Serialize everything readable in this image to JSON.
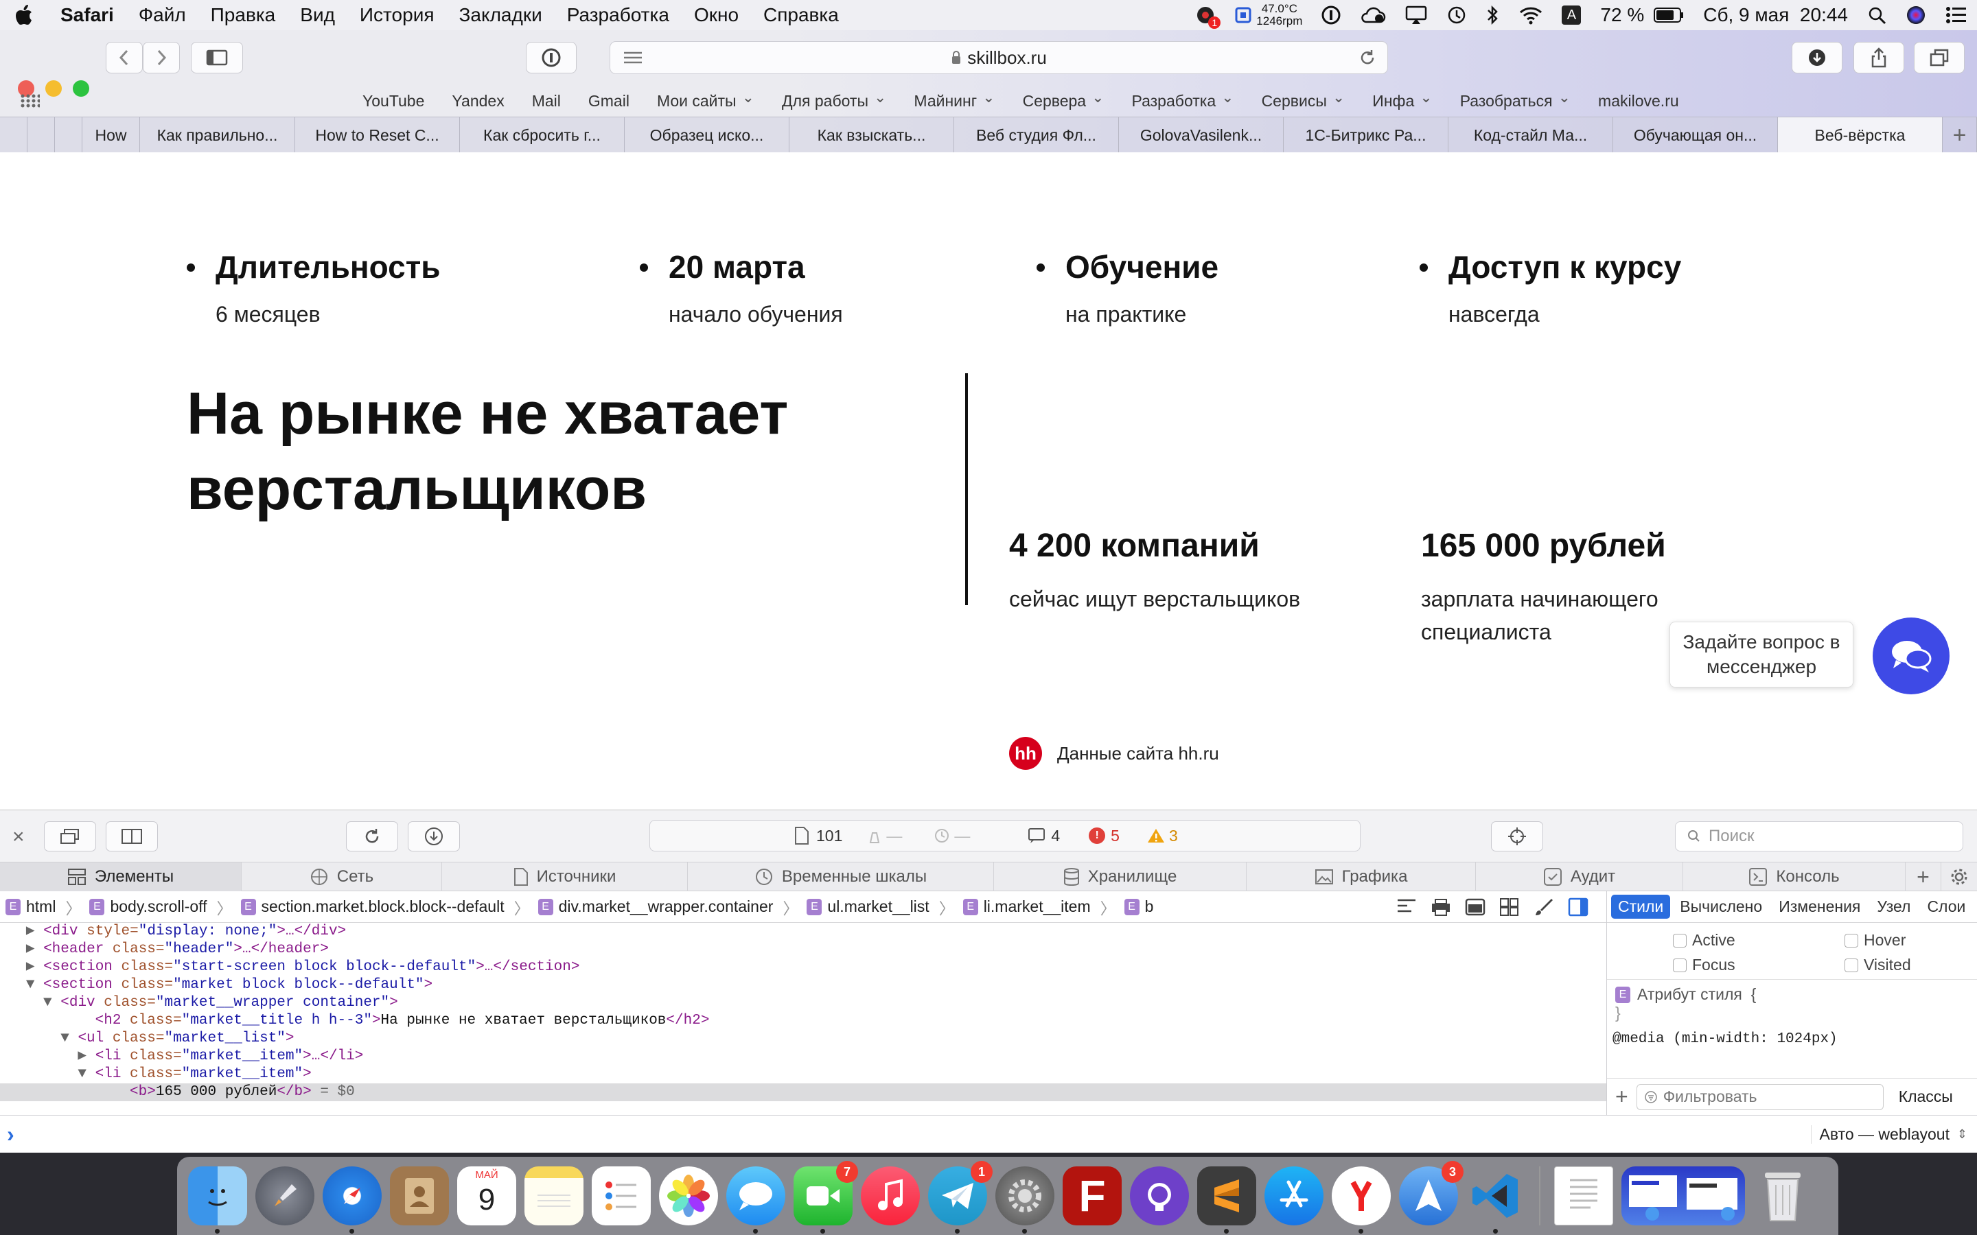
{
  "menubar": {
    "app_name": "Safari",
    "items": [
      "Файл",
      "Правка",
      "Вид",
      "История",
      "Закладки",
      "Разработка",
      "Окно",
      "Справка"
    ],
    "temp": "47.0°C",
    "rpm": "1246rpm",
    "battery": "72 %",
    "datetime": "Сб, 9 мая  20:44",
    "notification_count": "1"
  },
  "browser": {
    "url": "skillbox.ru",
    "favorites": [
      "YouTube",
      "Yandex",
      "Mail",
      "Gmail",
      "Мои сайты",
      "Для работы",
      "Майнинг",
      "Сервера",
      "Разработка",
      "Сервисы",
      "Инфа",
      "Разобраться",
      "makilove.ru"
    ],
    "favorites_with_menu": [
      false,
      false,
      false,
      false,
      true,
      true,
      true,
      true,
      true,
      true,
      true,
      true,
      false
    ],
    "tabs": [
      "How",
      "Как правильно...",
      "How to Reset C...",
      "Как сбросить г...",
      "Образец иско...",
      "Как взыскать...",
      "Веб студия Фл...",
      "GolovaVasilenk...",
      "1С-Битрикс Ра...",
      "Код-стайл Ма...",
      "Обучающая он...",
      "Веб-вёрстка"
    ],
    "active_tab": 11
  },
  "course_stats": [
    {
      "title": "Длительность",
      "sub": "6 месяцев"
    },
    {
      "title": "20 марта",
      "sub": "начало обучения"
    },
    {
      "title": "Обучение",
      "sub": "на практике"
    },
    {
      "title": "Доступ к курсу",
      "sub": "навсегда"
    }
  ],
  "market": {
    "title": "На рынке не хватает верстальщиков",
    "items": [
      {
        "title": "4 200 компаний",
        "sub": "сейчас ищут верстальщиков"
      },
      {
        "title": "165 000 рублей",
        "sub": "зарплата начинающего специалиста"
      }
    ],
    "source_logo": "hh",
    "source_text": "Данные сайта hh.ru"
  },
  "chat": {
    "bubble": "Задайте вопрос в мессенджер"
  },
  "devtools": {
    "resource_count": "101",
    "dash1": "—",
    "dash2": "—",
    "log_count": "4",
    "error_count": "5",
    "warning_count": "3",
    "search_placeholder": "Поиск",
    "tabs": [
      "Элементы",
      "Сеть",
      "Источники",
      "Временные шкалы",
      "Хранилище",
      "Графика",
      "Аудит",
      "Консоль"
    ],
    "breadcrumb": [
      "html",
      "body.scroll-off",
      "section.market.block.block--default",
      "div.market__wrapper.container",
      "ul.market__list",
      "li.market__item",
      "b"
    ],
    "dom_lines": [
      {
        "indent": 3,
        "tri": "▶",
        "tag_open": "<div",
        "attr": " style=",
        "val": "\"display: none;\"",
        "rest": ">…</div>"
      },
      {
        "indent": 3,
        "tri": "▶",
        "tag_open": "<header",
        "attr": " class=",
        "val": "\"header\"",
        "rest": ">…</header>"
      },
      {
        "indent": 3,
        "tri": "▶",
        "tag_open": "<section",
        "attr": " class=",
        "val": "\"start-screen block block--default\"",
        "rest": ">…</section>"
      },
      {
        "indent": 3,
        "tri": "▼",
        "tag_open": "<section",
        "attr": " class=",
        "val": "\"market block block--default\"",
        "rest": ">"
      },
      {
        "indent": 5,
        "tri": "▼",
        "tag_open": "<div",
        "attr": " class=",
        "val": "\"market__wrapper container\"",
        "rest": ">"
      },
      {
        "indent": 9,
        "tri": " ",
        "tag_open": "<h2",
        "attr": " class=",
        "val": "\"market__title h h--3\"",
        "rest": ">",
        "text": "На рынке не хватает верстальщиков",
        "close": "</h2>"
      },
      {
        "indent": 7,
        "tri": "▼",
        "tag_open": "<ul",
        "attr": " class=",
        "val": "\"market__list\"",
        "rest": ">"
      },
      {
        "indent": 9,
        "tri": "▶",
        "tag_open": "<li",
        "attr": " class=",
        "val": "\"market__item\"",
        "rest": ">…</li>"
      },
      {
        "indent": 9,
        "tri": "▼",
        "tag_open": "<li",
        "attr": " class=",
        "val": "\"market__item\"",
        "rest": ">"
      },
      {
        "indent": 13,
        "tri": " ",
        "tag_open": "<b",
        "attr": "",
        "val": "",
        "rest": ">",
        "text": "165 000 рублей",
        "close": "</b>",
        "suffix": " = $0",
        "selected": true
      }
    ],
    "sidebar_tabs": [
      "Стили",
      "Вычислено",
      "Изменения",
      "Узел",
      "Слои"
    ],
    "pseudo": [
      "Active",
      "Hover",
      "Focus",
      "Visited"
    ],
    "style_attr": "Атрибут стиля  {",
    "style_close": "}",
    "media": "@media (min-width: 1024px)",
    "filter_placeholder": "Фильтровать",
    "classes_label": "Классы",
    "console_prompt": "›",
    "console_context": "Авто — weblayout"
  },
  "dock": {
    "calendar_month": "МАЙ",
    "calendar_day": "9",
    "badges": {
      "facetime": "7",
      "telegram": "1",
      "send": "3"
    }
  },
  "colors": {
    "accent": "#3e4ae6",
    "hh_red": "#d6001c",
    "selected_tab": "#2a6dde"
  }
}
